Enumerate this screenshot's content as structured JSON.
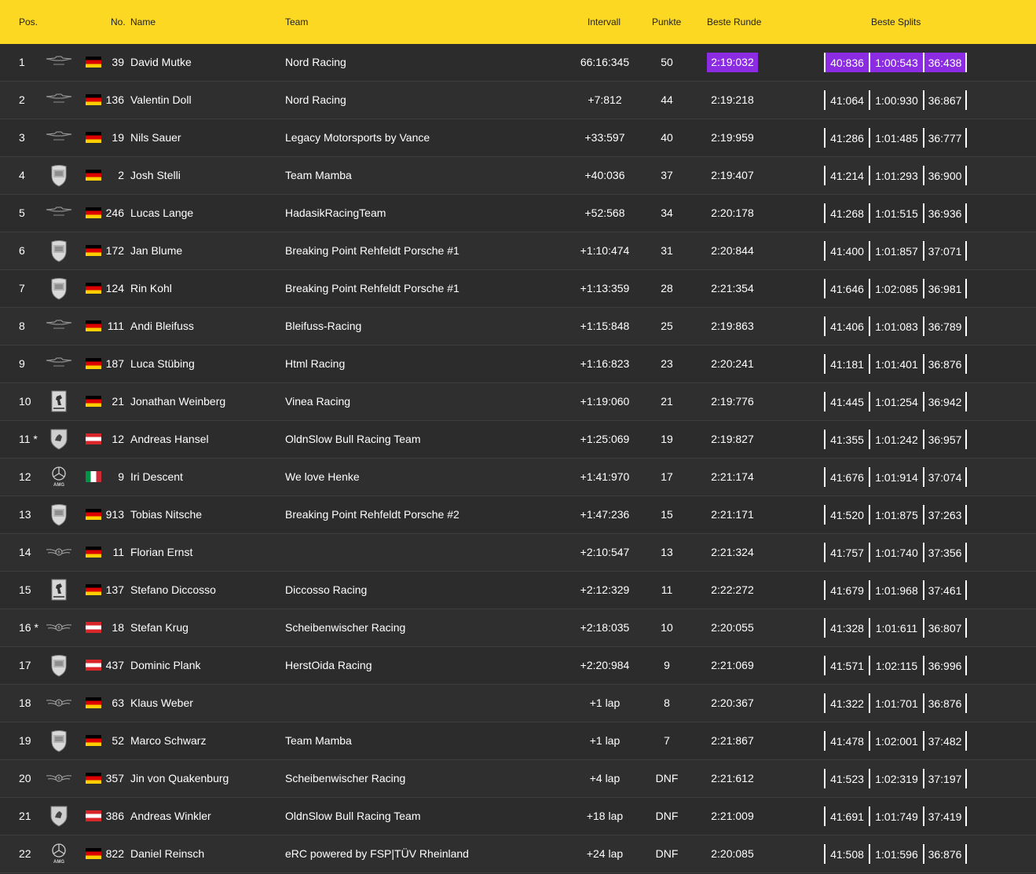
{
  "header": {
    "pos": "Pos.",
    "no": "No.",
    "name": "Name",
    "team": "Team",
    "interval": "Intervall",
    "points": "Punkte",
    "best_lap": "Beste Runde",
    "best_splits": "Beste Splits"
  },
  "colors": {
    "header_bg": "#fdd823",
    "fastest_highlight": "#8b2be2",
    "row_bg": "#2c2c2c"
  },
  "rows": [
    {
      "pos": "1",
      "logo": "aston-martin-icon",
      "flag": "de",
      "num": "39",
      "name": "David Mutke",
      "team": "Nord Racing",
      "interval": "66:16:345",
      "points": "50",
      "best": "2:19:032",
      "best_fastest": true,
      "s1": "40:836",
      "s2": "1:00:543",
      "s3": "36:438",
      "splits_fastest": true
    },
    {
      "pos": "2",
      "logo": "aston-martin-icon",
      "flag": "de",
      "num": "136",
      "name": "Valentin Doll",
      "team": "Nord Racing",
      "interval": "+7:812",
      "points": "44",
      "best": "2:19:218",
      "s1": "41:064",
      "s2": "1:00:930",
      "s3": "36:867"
    },
    {
      "pos": "3",
      "logo": "aston-martin-icon",
      "flag": "de",
      "num": "19",
      "name": "Nils Sauer",
      "team": "Legacy Motorsports by Vance",
      "interval": "+33:597",
      "points": "40",
      "best": "2:19:959",
      "s1": "41:286",
      "s2": "1:01:485",
      "s3": "36:777"
    },
    {
      "pos": "4",
      "logo": "porsche-icon",
      "flag": "de",
      "num": "2",
      "name": "Josh Stelli",
      "team": "Team Mamba",
      "interval": "+40:036",
      "points": "37",
      "best": "2:19:407",
      "s1": "41:214",
      "s2": "1:01:293",
      "s3": "36:900"
    },
    {
      "pos": "5",
      "logo": "aston-martin-icon",
      "flag": "de",
      "num": "246",
      "name": "Lucas Lange",
      "team": "HadasikRacingTeam",
      "interval": "+52:568",
      "points": "34",
      "best": "2:20:178",
      "s1": "41:268",
      "s2": "1:01:515",
      "s3": "36:936"
    },
    {
      "pos": "6",
      "logo": "porsche-icon",
      "flag": "de",
      "num": "172",
      "name": "Jan Blume",
      "team": "Breaking Point Rehfeldt Porsche #1",
      "interval": "+1:10:474",
      "points": "31",
      "best": "2:20:844",
      "s1": "41:400",
      "s2": "1:01:857",
      "s3": "37:071"
    },
    {
      "pos": "7",
      "logo": "porsche-icon",
      "flag": "de",
      "num": "124",
      "name": "Rin Kohl",
      "team": "Breaking Point Rehfeldt Porsche #1",
      "interval": "+1:13:359",
      "points": "28",
      "best": "2:21:354",
      "s1": "41:646",
      "s2": "1:02:085",
      "s3": "36:981"
    },
    {
      "pos": "8",
      "logo": "aston-martin-icon",
      "flag": "de",
      "num": "111",
      "name": "Andi Bleifuss",
      "team": "Bleifuss-Racing",
      "interval": "+1:15:848",
      "points": "25",
      "best": "2:19:863",
      "s1": "41:406",
      "s2": "1:01:083",
      "s3": "36:789"
    },
    {
      "pos": "9",
      "logo": "aston-martin-icon",
      "flag": "de",
      "num": "187",
      "name": "Luca Stübing",
      "team": "Html Racing",
      "interval": "+1:16:823",
      "points": "23",
      "best": "2:20:241",
      "s1": "41:181",
      "s2": "1:01:401",
      "s3": "36:876"
    },
    {
      "pos": "10",
      "logo": "ferrari-icon",
      "flag": "de",
      "num": "21",
      "name": "Jonathan Weinberg",
      "team": "Vinea Racing",
      "interval": "+1:19:060",
      "points": "21",
      "best": "2:19:776",
      "s1": "41:445",
      "s2": "1:01:254",
      "s3": "36:942"
    },
    {
      "pos": "11 *",
      "logo": "lamborghini-icon",
      "flag": "at",
      "num": "12",
      "name": "Andreas Hansel",
      "team": "OldnSlow Bull Racing Team",
      "interval": "+1:25:069",
      "points": "19",
      "best": "2:19:827",
      "s1": "41:355",
      "s2": "1:01:242",
      "s3": "36:957"
    },
    {
      "pos": "12",
      "logo": "mercedes-amg-icon",
      "flag": "it",
      "num": "9",
      "name": "Iri Descent",
      "team": "We love Henke",
      "interval": "+1:41:970",
      "points": "17",
      "best": "2:21:174",
      "s1": "41:676",
      "s2": "1:01:914",
      "s3": "37:074"
    },
    {
      "pos": "13",
      "logo": "porsche-icon",
      "flag": "de",
      "num": "913",
      "name": "Tobias Nitsche",
      "team": "Breaking Point Rehfeldt Porsche #2",
      "interval": "+1:47:236",
      "points": "15",
      "best": "2:21:171",
      "s1": "41:520",
      "s2": "1:01:875",
      "s3": "37:263"
    },
    {
      "pos": "14",
      "logo": "bentley-icon",
      "flag": "de",
      "num": "11",
      "name": "Florian Ernst",
      "team": "",
      "interval": "+2:10:547",
      "points": "13",
      "best": "2:21:324",
      "s1": "41:757",
      "s2": "1:01:740",
      "s3": "37:356"
    },
    {
      "pos": "15",
      "logo": "ferrari-icon",
      "flag": "de",
      "num": "137",
      "name": "Stefano Diccosso",
      "team": "Diccosso Racing",
      "interval": "+2:12:329",
      "points": "11",
      "best": "2:22:272",
      "s1": "41:679",
      "s2": "1:01:968",
      "s3": "37:461"
    },
    {
      "pos": "16 *",
      "logo": "bentley-icon",
      "flag": "at",
      "num": "18",
      "name": "Stefan Krug",
      "team": "Scheibenwischer Racing",
      "interval": "+2:18:035",
      "points": "10",
      "best": "2:20:055",
      "s1": "41:328",
      "s2": "1:01:611",
      "s3": "36:807"
    },
    {
      "pos": "17",
      "logo": "porsche-icon",
      "flag": "at",
      "num": "437",
      "name": "Dominic Plank",
      "team": "HerstOida Racing",
      "interval": "+2:20:984",
      "points": "9",
      "best": "2:21:069",
      "s1": "41:571",
      "s2": "1:02:115",
      "s3": "36:996"
    },
    {
      "pos": "18",
      "logo": "bentley-icon",
      "flag": "de",
      "num": "63",
      "name": "Klaus Weber",
      "team": "",
      "interval": "+1 lap",
      "points": "8",
      "best": "2:20:367",
      "s1": "41:322",
      "s2": "1:01:701",
      "s3": "36:876"
    },
    {
      "pos": "19",
      "logo": "porsche-icon",
      "flag": "de",
      "num": "52",
      "name": "Marco Schwarz",
      "team": "Team Mamba",
      "interval": "+1 lap",
      "points": "7",
      "best": "2:21:867",
      "s1": "41:478",
      "s2": "1:02:001",
      "s3": "37:482"
    },
    {
      "pos": "20",
      "logo": "bentley-icon",
      "flag": "de",
      "num": "357",
      "name": "Jin von Quakenburg",
      "team": "Scheibenwischer Racing",
      "interval": "+4 lap",
      "points": "DNF",
      "best": "2:21:612",
      "s1": "41:523",
      "s2": "1:02:319",
      "s3": "37:197"
    },
    {
      "pos": "21",
      "logo": "lamborghini-icon",
      "flag": "at",
      "num": "386",
      "name": "Andreas Winkler",
      "team": "OldnSlow Bull Racing Team",
      "interval": "+18 lap",
      "points": "DNF",
      "best": "2:21:009",
      "s1": "41:691",
      "s2": "1:01:749",
      "s3": "37:419"
    },
    {
      "pos": "22",
      "logo": "mercedes-amg-icon",
      "flag": "de",
      "num": "822",
      "name": "Daniel Reinsch",
      "team": "eRC powered by FSP|TÜV Rheinland",
      "interval": "+24 lap",
      "points": "DNF",
      "best": "2:20:085",
      "s1": "41:508",
      "s2": "1:01:596",
      "s3": "36:876"
    }
  ]
}
